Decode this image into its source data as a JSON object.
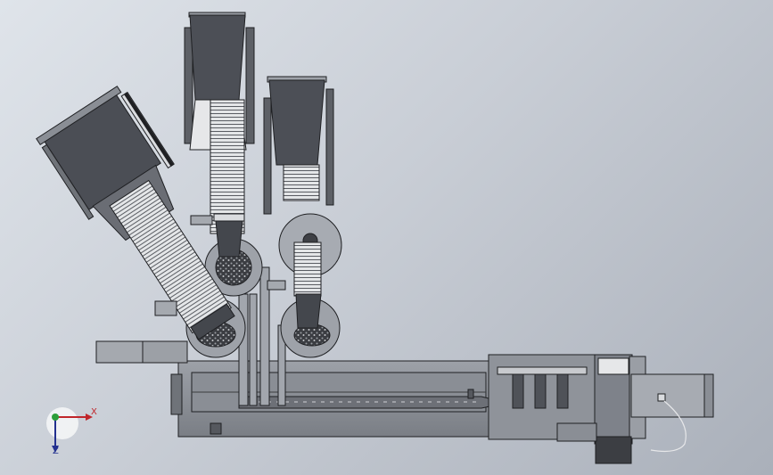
{
  "view": {
    "background_colors": [
      "#dfe4ea",
      "#aab0ba"
    ],
    "model_colors": {
      "body": "#8c9097",
      "body_dark": "#52555b",
      "hopper": "#4f5259",
      "rails": "#dadcdf",
      "edge": "#1f2023"
    }
  },
  "triad": {
    "x_label": "X",
    "z_label": "Z",
    "x_color": "#c0262b",
    "y_color": "#2c9e3a",
    "z_color": "#23308f"
  }
}
